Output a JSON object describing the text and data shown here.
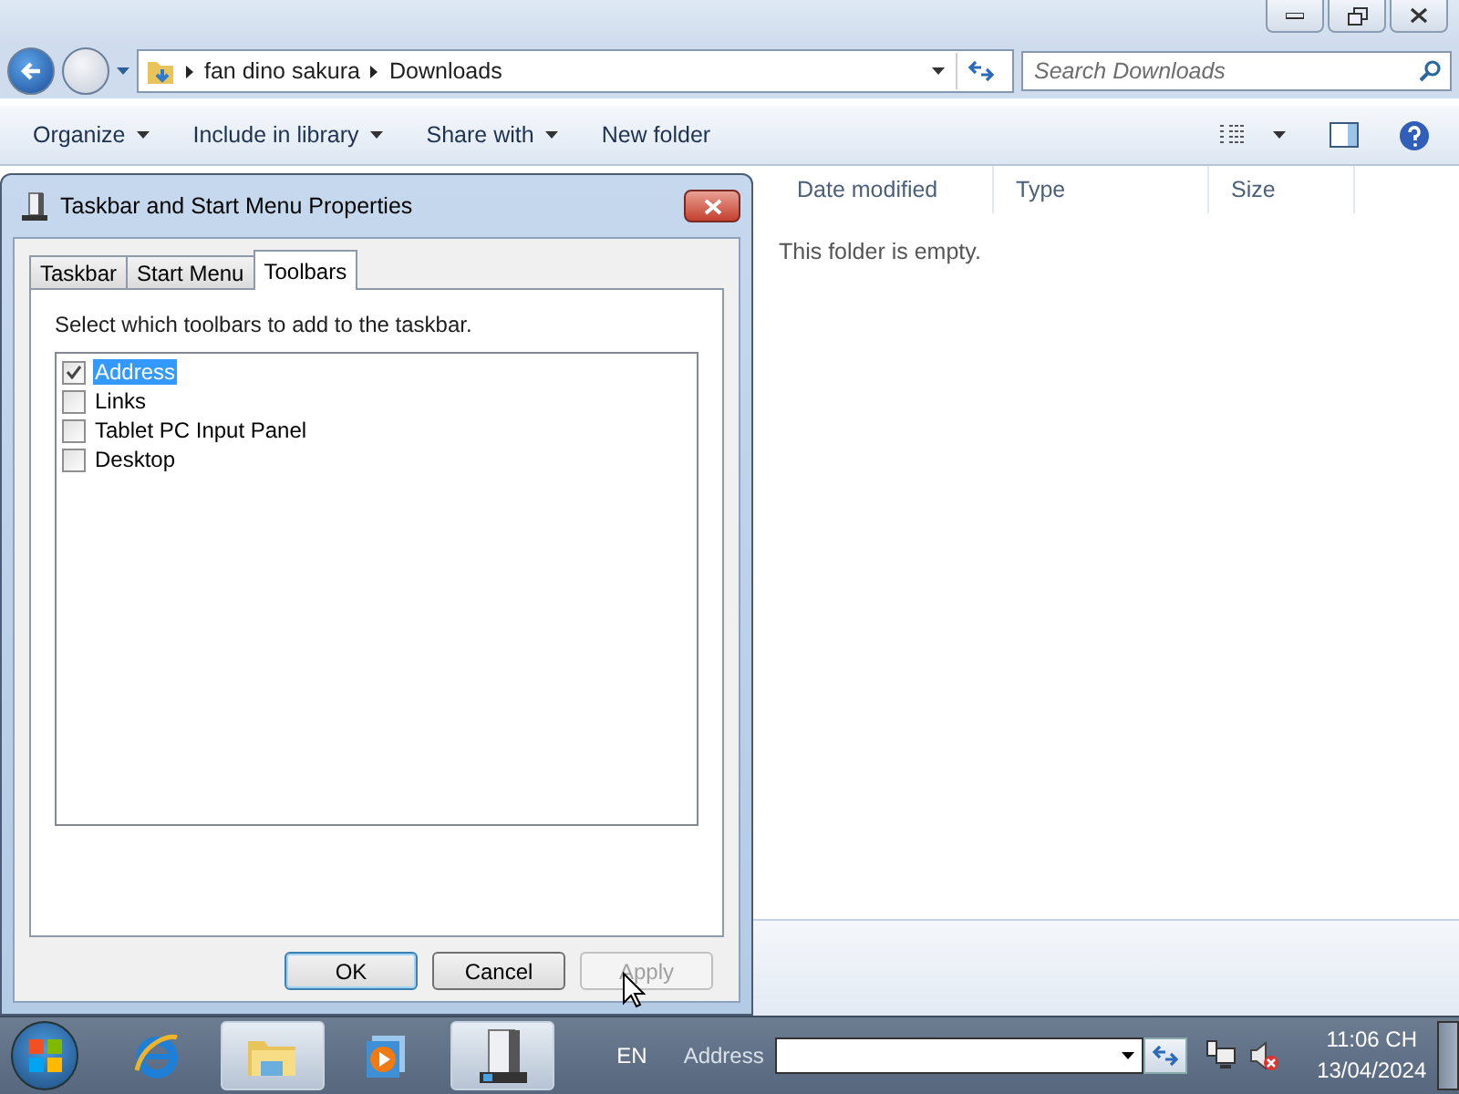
{
  "explorer": {
    "breadcrumb": [
      "fan dino sakura",
      "Downloads"
    ],
    "search": {
      "placeholder": "Search Downloads"
    },
    "toolbar": [
      {
        "label": "Organize",
        "menu": true
      },
      {
        "label": "Include in library",
        "menu": true
      },
      {
        "label": "Share with",
        "menu": true
      },
      {
        "label": "New folder",
        "menu": false
      }
    ],
    "columns": [
      "Date modified",
      "Type",
      "Size"
    ],
    "empty_message": "This folder is empty."
  },
  "dialog": {
    "title": "Taskbar and Start Menu Properties",
    "tabs": [
      {
        "label": "Taskbar",
        "selected": false
      },
      {
        "label": "Start Menu",
        "selected": false
      },
      {
        "label": "Toolbars",
        "selected": true
      }
    ],
    "instruction": "Select which toolbars to add to the taskbar.",
    "toolbars": [
      {
        "label": "Address",
        "checked": true,
        "selected": true
      },
      {
        "label": "Links",
        "checked": false,
        "selected": false
      },
      {
        "label": "Tablet PC Input Panel",
        "checked": false,
        "selected": false
      },
      {
        "label": "Desktop",
        "checked": false,
        "selected": false
      }
    ],
    "buttons": [
      {
        "label": "OK",
        "default": true,
        "disabled": false
      },
      {
        "label": "Cancel",
        "default": false,
        "disabled": false
      },
      {
        "label": "Apply",
        "default": false,
        "disabled": true
      }
    ]
  },
  "taskbar": {
    "apps": [
      {
        "kind": "browser",
        "active": false
      },
      {
        "kind": "folders",
        "active": true
      },
      {
        "kind": "media",
        "active": false
      },
      {
        "kind": "properties",
        "active": true
      }
    ],
    "language": "EN",
    "address_label": "Address",
    "clock": {
      "time": "11:06 CH",
      "date": "13/04/2024"
    }
  }
}
